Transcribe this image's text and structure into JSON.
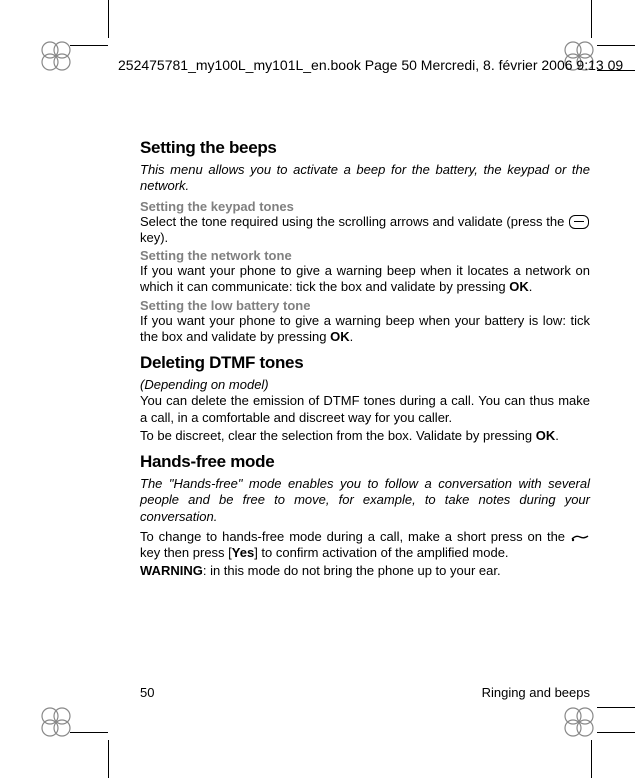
{
  "header": {
    "text": "252475781_my100L_my101L_en.book  Page 50  Mercredi, 8. février 2006  9:13 09"
  },
  "sections": {
    "beeps": {
      "title": "Setting the beeps",
      "intro": "This menu allows you to activate a beep for the battery, the keypad or the network.",
      "keypad": {
        "head": "Setting the keypad tones",
        "body_a": "Select the tone required using the scrolling arrows and validate (press the ",
        "body_b": " key)."
      },
      "network": {
        "head": "Setting the network tone",
        "body_a": "If you want your phone to give a warning beep when it locates a network on which it can communicate: tick the box and validate by pressing ",
        "ok": "OK",
        "body_b": "."
      },
      "battery": {
        "head": "Setting the low battery tone",
        "body_a": "If you want your phone to give a warning beep when your battery is low: tick the box and validate by pressing ",
        "ok": "OK",
        "body_b": "."
      }
    },
    "dtmf": {
      "title": "Deleting DTMF tones",
      "depend": "(Depending on model)",
      "body1": "You can delete the emission of DTMF tones during a call. You can thus make a call, in a comfortable and discreet way for you caller.",
      "body2_a": "To be discreet, clear the selection from the box. Validate by pressing ",
      "ok": "OK",
      "body2_b": "."
    },
    "handsfree": {
      "title": "Hands-free mode",
      "intro": "The \"Hands-free\" mode enables you to follow a conversation with several people and be free to move, for example, to take notes during your conversation.",
      "body_a": "To change to hands-free mode during a call, make a short press on the ",
      "body_b": " key then press [",
      "yes": "Yes",
      "body_c": "] to confirm activation of the amplified mode.",
      "warn_label": "WARNING",
      "warn_body": ": in this mode do not bring the phone up to your ear."
    }
  },
  "footer": {
    "page": "50",
    "chapter": "Ringing and beeps"
  }
}
